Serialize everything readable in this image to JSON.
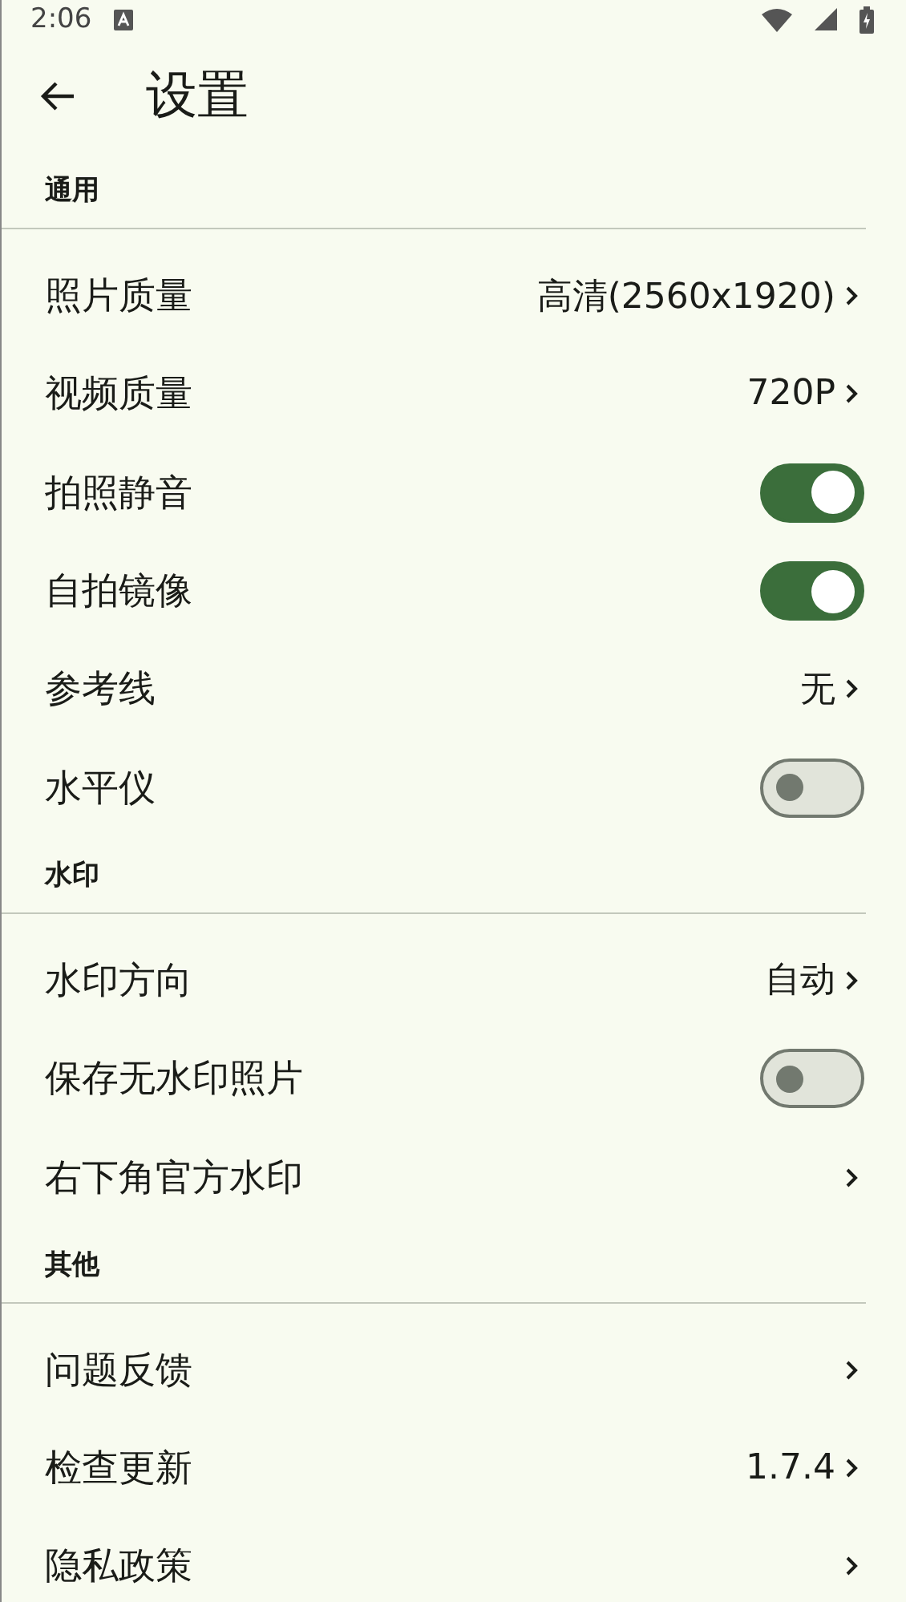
{
  "status_bar": {
    "time": "2:06"
  },
  "toolbar": {
    "title": "设置"
  },
  "sections": [
    {
      "title": "通用",
      "items": [
        {
          "kind": "nav",
          "label": "照片质量",
          "value": "高清(2560x1920)"
        },
        {
          "kind": "nav",
          "label": "视频质量",
          "value": "720P"
        },
        {
          "kind": "toggle",
          "label": "拍照静音",
          "on": true
        },
        {
          "kind": "toggle",
          "label": "自拍镜像",
          "on": true
        },
        {
          "kind": "nav",
          "label": "参考线",
          "value": "无"
        },
        {
          "kind": "toggle",
          "label": "水平仪",
          "on": false
        }
      ]
    },
    {
      "title": "水印",
      "items": [
        {
          "kind": "nav",
          "label": "水印方向",
          "value": "自动"
        },
        {
          "kind": "toggle",
          "label": "保存无水印照片",
          "on": false
        },
        {
          "kind": "nav",
          "label": "右下角官方水印"
        }
      ]
    },
    {
      "title": "其他",
      "items": [
        {
          "kind": "nav",
          "label": "问题反馈"
        },
        {
          "kind": "nav",
          "label": "检查更新",
          "value": "1.7.4"
        },
        {
          "kind": "nav",
          "label": "隐私政策"
        }
      ]
    }
  ]
}
